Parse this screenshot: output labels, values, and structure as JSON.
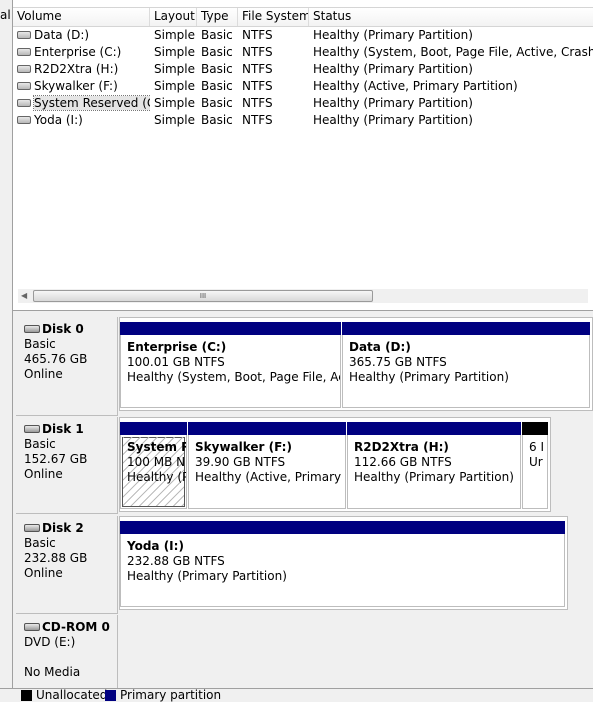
{
  "left_strip_text": "al",
  "columns": [
    "Volume",
    "Layout",
    "Type",
    "File System",
    "Status"
  ],
  "volumes": [
    {
      "name": "Data (D:)",
      "layout": "Simple",
      "type": "Basic",
      "fs": "NTFS",
      "status": "Healthy (Primary Partition)"
    },
    {
      "name": "Enterprise (C:)",
      "layout": "Simple",
      "type": "Basic",
      "fs": "NTFS",
      "status": "Healthy (System, Boot, Page File, Active, Crash Dump"
    },
    {
      "name": "R2D2Xtra (H:)",
      "layout": "Simple",
      "type": "Basic",
      "fs": "NTFS",
      "status": "Healthy (Primary Partition)"
    },
    {
      "name": "Skywalker (F:)",
      "layout": "Simple",
      "type": "Basic",
      "fs": "NTFS",
      "status": "Healthy (Active, Primary Partition)"
    },
    {
      "name": "System Reserved (G:)",
      "layout": "Simple",
      "type": "Basic",
      "fs": "NTFS",
      "status": "Healthy (Primary Partition)"
    },
    {
      "name": "Yoda (I:)",
      "layout": "Simple",
      "type": "Basic",
      "fs": "NTFS",
      "status": "Healthy (Primary Partition)"
    }
  ],
  "scrollbar": {
    "grip": "III"
  },
  "disks": [
    {
      "name": "Disk 0",
      "type": "Basic",
      "size": "465.76 GB",
      "state": "Online",
      "partitions": [
        {
          "name": "Enterprise  (C:)",
          "size": "100.01 GB NTFS",
          "status": "Healthy (System, Boot, Page File, Active"
        },
        {
          "name": "Data  (D:)",
          "size": "365.75 GB NTFS",
          "status": "Healthy (Primary Partition)"
        }
      ]
    },
    {
      "name": "Disk 1",
      "type": "Basic",
      "size": "152.67 GB",
      "state": "Online",
      "partitions": [
        {
          "name": "System R",
          "size": "100 MB N",
          "status": "Healthy (P"
        },
        {
          "name": "Skywalker  (F:)",
          "size": "39.90 GB NTFS",
          "status": "Healthy (Active, Primary Pa"
        },
        {
          "name": "R2D2Xtra  (H:)",
          "size": "112.66 GB NTFS",
          "status": "Healthy (Primary Partition)"
        },
        {
          "name": "",
          "size": "6 I",
          "status": "Ur"
        }
      ]
    },
    {
      "name": "Disk 2",
      "type": "Basic",
      "size": "232.88 GB",
      "state": "Online",
      "partitions": [
        {
          "name": "Yoda  (I:)",
          "size": "232.88 GB NTFS",
          "status": "Healthy (Primary Partition)"
        }
      ]
    }
  ],
  "cdrom": {
    "name": "CD-ROM 0",
    "drive": "DVD (E:)",
    "state": "No Media"
  },
  "legend": {
    "unallocated": "Unallocated",
    "primary": "Primary partition",
    "unallocated_color": "#000000",
    "primary_color": "#000080"
  }
}
